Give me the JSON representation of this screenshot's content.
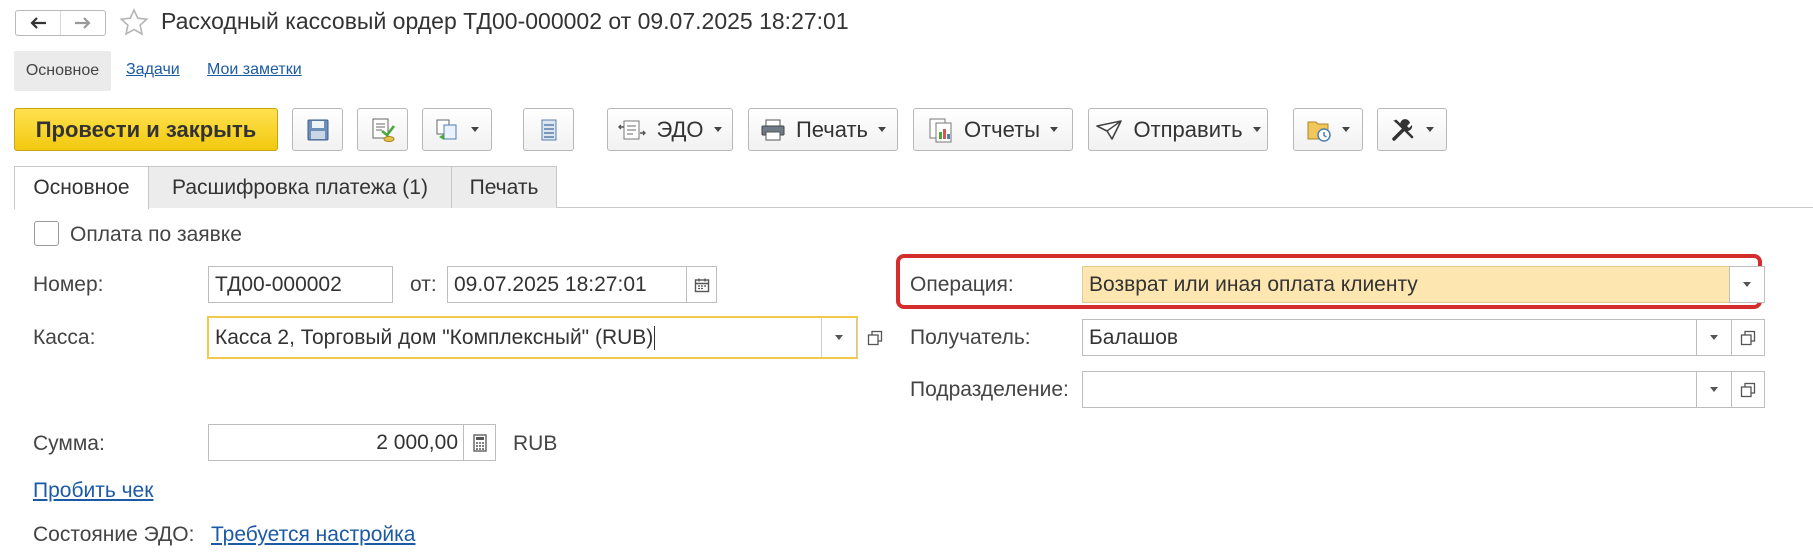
{
  "window": {
    "title": "Расходный кассовый ордер ТД00-000002 от 09.07.2025 18:27:01"
  },
  "top_nav": {
    "items": [
      {
        "label": "Основное"
      },
      {
        "label": "Задачи"
      },
      {
        "label": "Мои заметки"
      }
    ]
  },
  "toolbar": {
    "post_close_label": "Провести и закрыть",
    "edo_label": "ЭДО",
    "print_label": "Печать",
    "reports_label": "Отчеты",
    "send_label": "Отправить"
  },
  "tabs": [
    {
      "label": "Основное",
      "active": true
    },
    {
      "label": "Расшифровка платежа (1)",
      "active": false
    },
    {
      "label": "Печать",
      "active": false
    }
  ],
  "form": {
    "pay_by_request_label": "Оплата по заявке",
    "number_label": "Номер:",
    "number_value": "ТД00-000002",
    "date_label": "от:",
    "date_value": "09.07.2025 18:27:01",
    "cashbox_label": "Касса:",
    "cashbox_value": "Касса 2, Торговый дом \"Комплексный\" (RUB)",
    "operation_label": "Операция:",
    "operation_value": "Возврат или иная оплата клиенту",
    "recipient_label": "Получатель:",
    "recipient_value": "Балашов",
    "division_label": "Подразделение:",
    "division_value": "",
    "amount_label": "Сумма:",
    "amount_value": "2 000,00",
    "currency": "RUB",
    "print_receipt_link": "Пробить чек",
    "edo_state_label": "Состояние ЭДО:",
    "edo_state_link": "Требуется настройка"
  },
  "colors": {
    "primary_button": "#f5d01f",
    "link": "#1c5aa5",
    "highlight_field": "#fde6b0",
    "focus_border": "#f2c94c",
    "annotation_frame": "#d52c2c"
  }
}
